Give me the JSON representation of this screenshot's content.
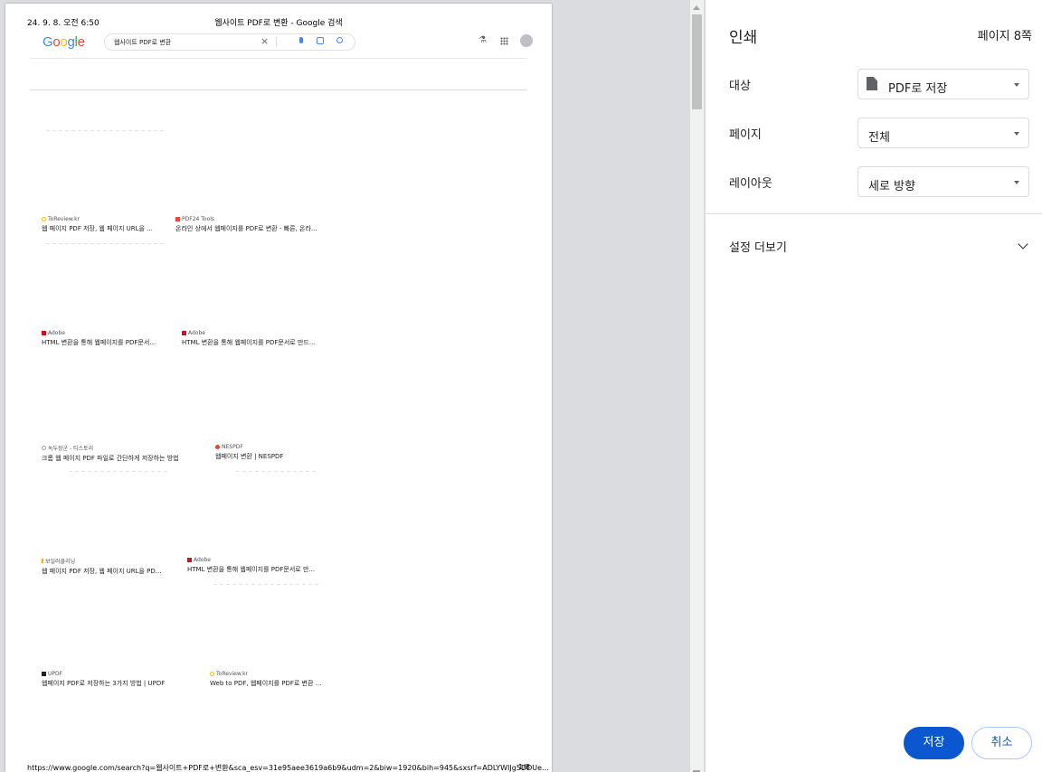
{
  "preview": {
    "header_date": "24. 9. 8. 오전 6:50",
    "header_title": "웹사이트 PDF로 변환 - Google 검색",
    "logo_letters": [
      "G",
      "o",
      "o",
      "g",
      "l",
      "e"
    ],
    "logo_colors": [
      "#4285f4",
      "#ea4335",
      "#fbbc05",
      "#4285f4",
      "#34a853",
      "#ea4335"
    ],
    "search_query": "웹사이트 PDF로 변환",
    "results": [
      {
        "source": "ToReview.kr",
        "title": "웹 페이지 PDF 저장, 웹 페이지 URL을 ...",
        "fav": "search-favicon",
        "color": "#fbbc05"
      },
      {
        "source": "PDF24 Tools",
        "title": "온라인 상에서 웹페이지를 PDF로 변환 - 빠른, 온라...",
        "fav": "pdf24-favicon",
        "color": "#e8453c"
      },
      {
        "source": "Adobe",
        "title": "HTML 변환을 통해 웹페이지를 PDF문서...",
        "fav": "adobe-favicon",
        "color": "#d3101e"
      },
      {
        "source": "Adobe",
        "title": "HTML 변환을 통해 웹페이지를 PDF문서로 만드...",
        "fav": "adobe-favicon",
        "color": "#d3101e"
      },
      {
        "source": "녹두장군 - 티스토리",
        "title": "크롬 웹 페이지 PDF 파일로 간단하게 저장하는 방법",
        "fav": "tistory-favicon",
        "color": "#9aa0a6"
      },
      {
        "source": "NESPDF",
        "title": "웹페이지 변환 | NESPDF",
        "fav": "nespdf-favicon",
        "color": "#ea4335"
      },
      {
        "source": "보일러클리닝",
        "title": "웹 페이지 PDF 저장, 웹 페이지 URL을 PD...",
        "fav": "blog-favicon",
        "color": "#f4b400"
      },
      {
        "source": "Adobe",
        "title": "HTML 변환을 통해 웹페이지를 PDF문서로 만...",
        "fav": "adobe-favicon",
        "color": "#d3101e"
      },
      {
        "source": "UPDF",
        "title": "웹페이지 PDF로 저장하는 3가지 방법 | UPDF",
        "fav": "updf-favicon",
        "color": "#202124"
      },
      {
        "source": "ToReview.kr",
        "title": "Web to PDF, 웹페이지를 PDF로 변환 ...",
        "fav": "search-favicon",
        "color": "#fbbc05"
      }
    ],
    "footer_url": "https://www.google.com/search?q=웹사이트+PDF로+변환&sca_esv=31e95aee3619a6b9&udm=2&biw=1920&bih=945&sxsrf=ADLYWIJg5DDUe...",
    "page_number": "1/8"
  },
  "print": {
    "title": "인쇄",
    "page_count": "페이지 8쪽",
    "destination_label": "대상",
    "destination_value": "PDF로 저장",
    "pages_label": "페이지",
    "pages_value": "전체",
    "layout_label": "레이아웃",
    "layout_value": "세로 방향",
    "more_settings": "설정 더보기",
    "save_button": "저장",
    "cancel_button": "취소",
    "accent_color": "#0b57d0"
  }
}
